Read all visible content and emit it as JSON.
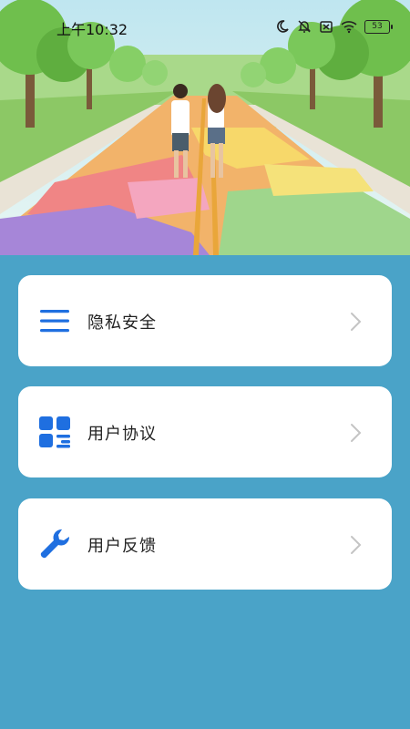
{
  "status_bar": {
    "time": "上午10:32",
    "battery": "53",
    "icons": [
      "moon-icon",
      "bell-off-icon",
      "sim-x-icon",
      "wifi-icon",
      "battery-icon"
    ]
  },
  "menu": {
    "items": [
      {
        "label": "隐私安全",
        "icon": "menu-lines-icon"
      },
      {
        "label": "用户协议",
        "icon": "grid-doc-icon"
      },
      {
        "label": "用户反馈",
        "icon": "wrench-icon"
      }
    ]
  },
  "colors": {
    "background": "#4aa3c8",
    "accent": "#1f6fe0",
    "card": "#ffffff"
  }
}
